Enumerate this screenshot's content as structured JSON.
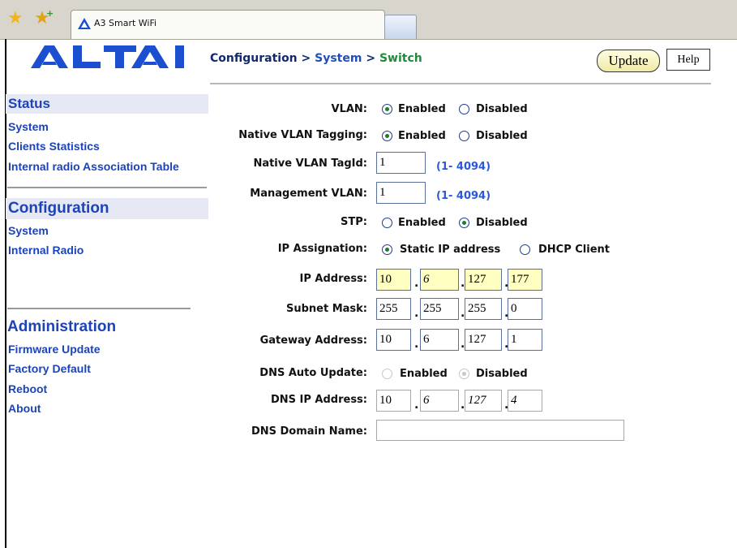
{
  "browser": {
    "tab_title": "A3 Smart WiFi"
  },
  "logo_text": "ALTAI",
  "breadcrumb": {
    "root": "Configuration",
    "separator": ">",
    "parent": "System",
    "current": "Switch"
  },
  "toolbar": {
    "update_label": "Update",
    "help_label": "Help"
  },
  "sidebar": {
    "status": {
      "title": "Status",
      "items": [
        "System",
        "Clients Statistics",
        "Internal radio Association Table"
      ]
    },
    "configuration": {
      "title": "Configuration",
      "items": [
        "System",
        "Internal Radio"
      ]
    },
    "administration": {
      "title": "Administration",
      "items": [
        "Firmware Update",
        "Factory Default",
        "Reboot",
        "About"
      ]
    }
  },
  "form": {
    "vlan": {
      "label": "VLAN:",
      "opt1": "Enabled",
      "opt2": "Disabled",
      "selected": "Enabled"
    },
    "native_vlan_tagging": {
      "label": "Native VLAN Tagging:",
      "opt1": "Enabled",
      "opt2": "Disabled",
      "selected": "Enabled"
    },
    "native_vlan_tagid": {
      "label": "Native VLAN TagId:",
      "value": "1",
      "range": "(1- 4094)"
    },
    "management_vlan": {
      "label": "Management VLAN:",
      "value": "1",
      "range": "(1- 4094)"
    },
    "stp": {
      "label": "STP:",
      "opt1": "Enabled",
      "opt2": "Disabled",
      "selected": "Disabled"
    },
    "ip_assignation": {
      "label": "IP Assignation:",
      "opt1": "Static IP address",
      "opt2": "DHCP Client",
      "selected": "Static IP address"
    },
    "ip_address": {
      "label": "IP Address:",
      "octets": [
        "10",
        "6",
        "127",
        "177"
      ]
    },
    "subnet_mask": {
      "label": "Subnet Mask:",
      "octets": [
        "255",
        "255",
        "255",
        "0"
      ]
    },
    "gateway_address": {
      "label": "Gateway Address:",
      "octets": [
        "10",
        "6",
        "127",
        "1"
      ]
    },
    "dns_auto_update": {
      "label": "DNS Auto Update:",
      "opt1": "Enabled",
      "opt2": "Disabled",
      "selected": "Disabled"
    },
    "dns_ip_address": {
      "label": "DNS IP Address:",
      "octets": [
        "10",
        "6",
        "127",
        "4"
      ]
    },
    "dns_domain_name": {
      "label": "DNS Domain Name:",
      "value": ""
    }
  },
  "colors": {
    "link": "#1c43b8",
    "section_bg": "#e6e8f4",
    "breadcrumb_current": "#1f8a3a",
    "highlight_field": "#ffffc2",
    "range_text": "#2a58d8"
  }
}
